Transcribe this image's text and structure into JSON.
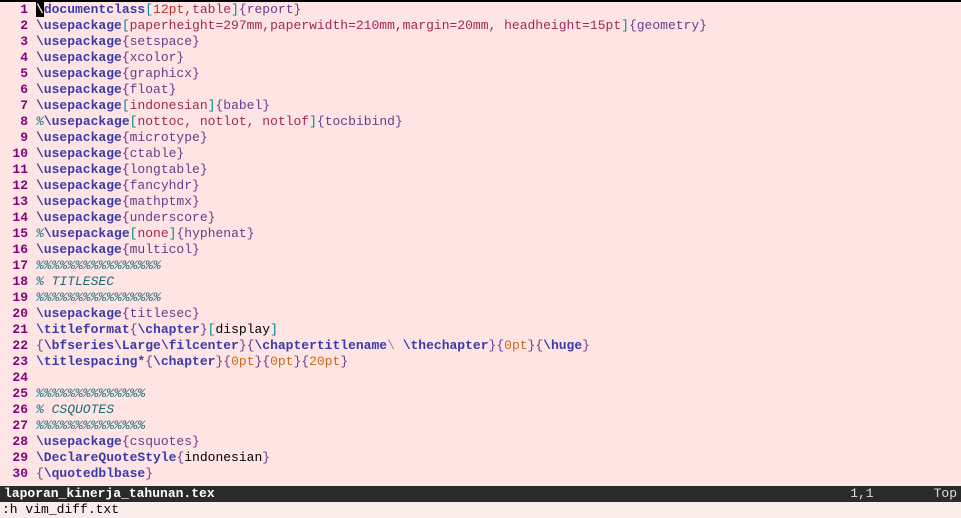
{
  "status": {
    "filename": "laporan_kinerja_tahunan.tex",
    "position": "1,1",
    "scroll": "Top"
  },
  "cmdline": ":h vim_diff.txt",
  "lines": {
    "1": {
      "no": "1",
      "tokens": [
        {
          "cls": "c-nav cursor",
          "t": "\\"
        },
        {
          "cls": "c-nav",
          "t": "documentclass"
        },
        {
          "cls": "c-cyan",
          "t": "["
        },
        {
          "cls": "c-red",
          "t": "12pt"
        },
        {
          "cls": "c-str",
          "t": ",table"
        },
        {
          "cls": "c-cyan",
          "t": "]"
        },
        {
          "cls": "c-fn",
          "t": "{report}"
        }
      ]
    },
    "2": {
      "no": "2",
      "tokens": [
        {
          "cls": "c-nav",
          "t": "\\usepackage"
        },
        {
          "cls": "c-cyan",
          "t": "["
        },
        {
          "cls": "c-str",
          "t": "paperheight=297mm,paperwidth=210mm,margin=20mm, headheight=15pt"
        },
        {
          "cls": "c-cyan",
          "t": "]"
        },
        {
          "cls": "c-fn",
          "t": "{geometry}"
        }
      ]
    },
    "3": {
      "no": "3",
      "tokens": [
        {
          "cls": "c-nav",
          "t": "\\usepackage"
        },
        {
          "cls": "c-fn",
          "t": "{setspace}"
        }
      ]
    },
    "4": {
      "no": "4",
      "tokens": [
        {
          "cls": "c-nav",
          "t": "\\usepackage"
        },
        {
          "cls": "c-fn",
          "t": "{xcolor}"
        }
      ]
    },
    "5": {
      "no": "5",
      "tokens": [
        {
          "cls": "c-nav",
          "t": "\\usepackage"
        },
        {
          "cls": "c-fn",
          "t": "{graphicx}"
        }
      ]
    },
    "6": {
      "no": "6",
      "tokens": [
        {
          "cls": "c-nav",
          "t": "\\usepackage"
        },
        {
          "cls": "c-fn",
          "t": "{float}"
        }
      ]
    },
    "7": {
      "no": "7",
      "tokens": [
        {
          "cls": "c-nav",
          "t": "\\usepackage"
        },
        {
          "cls": "c-cyan",
          "t": "["
        },
        {
          "cls": "c-str",
          "t": "indonesian"
        },
        {
          "cls": "c-cyan",
          "t": "]"
        },
        {
          "cls": "c-fn",
          "t": "{babel}"
        }
      ]
    },
    "8": {
      "no": "8",
      "tokens": [
        {
          "cls": "c-cmt",
          "t": "%"
        },
        {
          "cls": "c-nav",
          "t": "\\usepackage"
        },
        {
          "cls": "c-cyan",
          "t": "["
        },
        {
          "cls": "c-str",
          "t": "nottoc, notlot, notlof"
        },
        {
          "cls": "c-cyan",
          "t": "]"
        },
        {
          "cls": "c-fn",
          "t": "{tocbibind}"
        }
      ]
    },
    "9": {
      "no": "9",
      "tokens": [
        {
          "cls": "c-nav",
          "t": "\\usepackage"
        },
        {
          "cls": "c-fn",
          "t": "{microtype}"
        }
      ]
    },
    "10": {
      "no": "10",
      "tokens": [
        {
          "cls": "c-nav",
          "t": "\\usepackage"
        },
        {
          "cls": "c-fn",
          "t": "{ctable}"
        }
      ]
    },
    "11": {
      "no": "11",
      "tokens": [
        {
          "cls": "c-nav",
          "t": "\\usepackage"
        },
        {
          "cls": "c-fn",
          "t": "{longtable}"
        }
      ]
    },
    "12": {
      "no": "12",
      "tokens": [
        {
          "cls": "c-nav",
          "t": "\\usepackage"
        },
        {
          "cls": "c-fn",
          "t": "{fancyhdr}"
        }
      ]
    },
    "13": {
      "no": "13",
      "tokens": [
        {
          "cls": "c-nav",
          "t": "\\usepackage"
        },
        {
          "cls": "c-fn",
          "t": "{mathptmx}"
        }
      ]
    },
    "14": {
      "no": "14",
      "tokens": [
        {
          "cls": "c-nav",
          "t": "\\usepackage"
        },
        {
          "cls": "c-fn",
          "t": "{underscore}"
        }
      ]
    },
    "15": {
      "no": "15",
      "tokens": [
        {
          "cls": "c-cmt",
          "t": "%"
        },
        {
          "cls": "c-nav",
          "t": "\\usepackage"
        },
        {
          "cls": "c-cyan",
          "t": "["
        },
        {
          "cls": "c-str",
          "t": "none"
        },
        {
          "cls": "c-cyan",
          "t": "]"
        },
        {
          "cls": "c-fn",
          "t": "{hyphenat}"
        }
      ]
    },
    "16": {
      "no": "16",
      "tokens": [
        {
          "cls": "c-nav",
          "t": "\\usepackage"
        },
        {
          "cls": "c-fn",
          "t": "{multicol}"
        }
      ]
    },
    "17": {
      "no": "17",
      "tokens": [
        {
          "cls": "c-cmt",
          "t": "%%%%%%%%%%%%%%%%"
        }
      ]
    },
    "18": {
      "no": "18",
      "tokens": [
        {
          "cls": "c-cmt",
          "t": "% TITLESEC"
        }
      ]
    },
    "19": {
      "no": "19",
      "tokens": [
        {
          "cls": "c-cmt",
          "t": "%%%%%%%%%%%%%%%%"
        }
      ]
    },
    "20": {
      "no": "20",
      "tokens": [
        {
          "cls": "c-nav",
          "t": "\\usepackage"
        },
        {
          "cls": "c-fn",
          "t": "{titlesec}"
        }
      ]
    },
    "21": {
      "no": "21",
      "tokens": [
        {
          "cls": "c-nav",
          "t": "\\titleformat"
        },
        {
          "cls": "c-fn",
          "t": "{"
        },
        {
          "cls": "c-nav",
          "t": "\\chapter"
        },
        {
          "cls": "c-fn",
          "t": "}"
        },
        {
          "cls": "c-cyan",
          "t": "["
        },
        {
          "cls": "c-black",
          "t": "display"
        },
        {
          "cls": "c-cyan",
          "t": "]"
        }
      ]
    },
    "22": {
      "no": "22",
      "tokens": [
        {
          "cls": "c-fn",
          "t": "{"
        },
        {
          "cls": "c-nav",
          "t": "\\bfseries\\Large\\filcenter"
        },
        {
          "cls": "c-fn",
          "t": "}{"
        },
        {
          "cls": "c-nav",
          "t": "\\chaptertitlename"
        },
        {
          "cls": "c-dim",
          "t": "\\ "
        },
        {
          "cls": "c-nav",
          "t": "\\thechapter"
        },
        {
          "cls": "c-fn",
          "t": "}{"
        },
        {
          "cls": "c-orange",
          "t": "0pt"
        },
        {
          "cls": "c-fn",
          "t": "}{"
        },
        {
          "cls": "c-nav",
          "t": "\\huge"
        },
        {
          "cls": "c-fn",
          "t": "}"
        }
      ]
    },
    "23": {
      "no": "23",
      "tokens": [
        {
          "cls": "c-nav",
          "t": "\\titlespacing*"
        },
        {
          "cls": "c-fn",
          "t": "{"
        },
        {
          "cls": "c-nav",
          "t": "\\chapter"
        },
        {
          "cls": "c-fn",
          "t": "}{"
        },
        {
          "cls": "c-orange",
          "t": "0pt"
        },
        {
          "cls": "c-fn",
          "t": "}{"
        },
        {
          "cls": "c-orange",
          "t": "0pt"
        },
        {
          "cls": "c-fn",
          "t": "}{"
        },
        {
          "cls": "c-orange",
          "t": "20pt"
        },
        {
          "cls": "c-fn",
          "t": "}"
        }
      ]
    },
    "24": {
      "no": "24",
      "tokens": []
    },
    "25": {
      "no": "25",
      "tokens": [
        {
          "cls": "c-cmt",
          "t": "%%%%%%%%%%%%%%"
        }
      ]
    },
    "26": {
      "no": "26",
      "tokens": [
        {
          "cls": "c-cmt",
          "t": "% CSQUOTES"
        }
      ]
    },
    "27": {
      "no": "27",
      "tokens": [
        {
          "cls": "c-cmt",
          "t": "%%%%%%%%%%%%%%"
        }
      ]
    },
    "28": {
      "no": "28",
      "tokens": [
        {
          "cls": "c-nav",
          "t": "\\usepackage"
        },
        {
          "cls": "c-fn",
          "t": "{csquotes}"
        }
      ]
    },
    "29": {
      "no": "29",
      "tokens": [
        {
          "cls": "c-nav",
          "t": "\\DeclareQuoteStyle"
        },
        {
          "cls": "c-fn",
          "t": "{"
        },
        {
          "cls": "c-black",
          "t": "indonesian"
        },
        {
          "cls": "c-fn",
          "t": "}"
        }
      ]
    },
    "30": {
      "no": "30",
      "tokens": [
        {
          "cls": "c-fn",
          "t": "{"
        },
        {
          "cls": "c-nav",
          "t": "\\quotedblbase"
        },
        {
          "cls": "c-fn",
          "t": "}"
        }
      ]
    }
  }
}
